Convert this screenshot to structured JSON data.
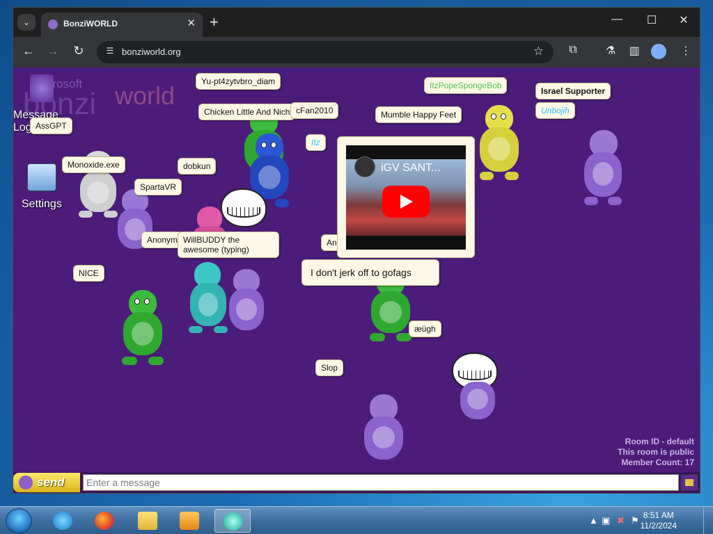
{
  "browser": {
    "tab_title": "BonziWORLD",
    "url": "bonziworld.org",
    "tab_close_glyph": "✕",
    "new_tab_glyph": "+",
    "window_controls": {
      "minimize": "—",
      "maximize": "☐",
      "close": "✕"
    }
  },
  "page": {
    "logo": {
      "top": "Bonzi",
      "main": "bonzi",
      "accent": "world",
      "small": "Microsoft"
    },
    "sidebar": {
      "message_log_label": "Message Log",
      "settings_label": "Settings"
    },
    "bubbles": {
      "yu": "Yu-pt4zytvbro_diam",
      "chicken": "Chicken Little And Nich",
      "fan": "cFan2010",
      "itz_pope": "ItzPopeSpongeBob",
      "israel": "Israel Supporter",
      "unbojih": "Unbojih",
      "mumble": "Mumble Happy Feet",
      "assgpt": "AssGPT",
      "monoxide": "Monoxide.exe",
      "dobkun": "dobkun",
      "spartavr": "SpartaVR",
      "anonym_partial": "Anonym",
      "willbuddy": "WillBUDDY the awesome (typing)",
      "anonymous": "Anonymous",
      "nice": "NICE",
      "jerk": "I don't jerk off to gofags",
      "aeugh": "æügh",
      "slop": "Slop",
      "itz_partial": "Itz"
    },
    "video": {
      "title": "iGV SANT..."
    },
    "room_info": {
      "room_id": "Room ID - default",
      "public": "This room is public",
      "member_count": "Member Count: 17"
    },
    "chat": {
      "send_label": "send",
      "placeholder": "Enter a message"
    }
  },
  "taskbar": {
    "time": "8:51 AM",
    "date": "11/2/2024"
  },
  "colors": {
    "page_bg": "#4b1c7a",
    "bubble_bg": "#fdf9e6",
    "bonzi_purple": "#9b78d6",
    "bonzi_green": "#3dbb3d",
    "bonzi_blue": "#2b56d6",
    "bonzi_yellow": "#e3e04a",
    "bonzi_white": "#d9d9d9",
    "bonzi_pink": "#e05aa8",
    "bonzi_teal": "#3fc7c7"
  },
  "icons": [
    "search-icon",
    "back-icon",
    "forward-icon",
    "reload-icon",
    "site-info-icon",
    "star-icon",
    "extensions-icon",
    "labs-icon",
    "side-panel-icon",
    "profile-icon",
    "menu-icon"
  ]
}
